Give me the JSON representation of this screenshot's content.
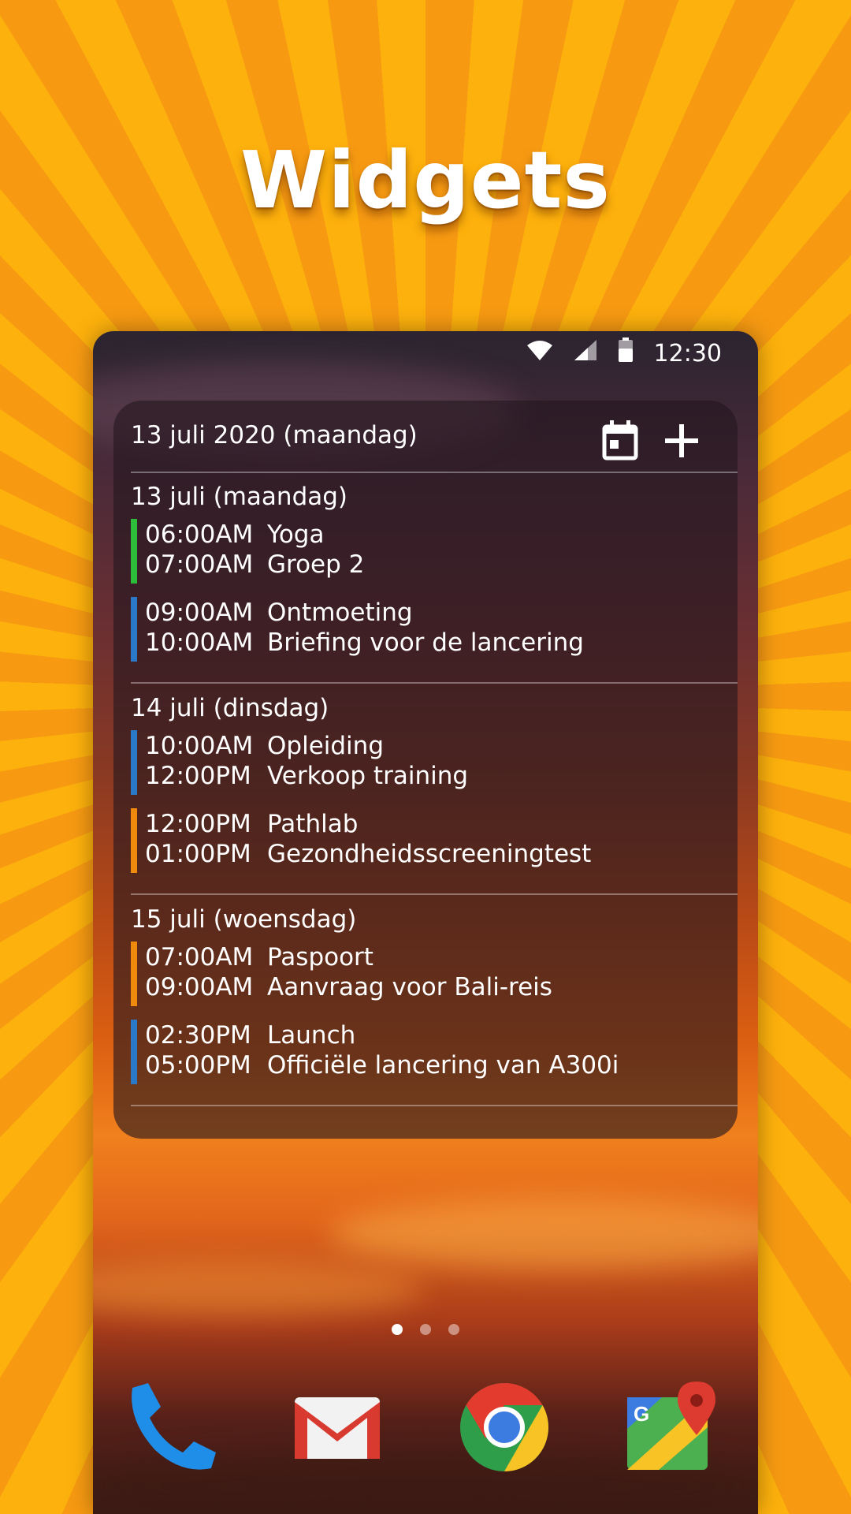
{
  "headline": "Widgets",
  "status_bar": {
    "time": "12:30",
    "icons": [
      "wifi-icon",
      "signal-icon",
      "battery-icon"
    ]
  },
  "widget": {
    "title": "13 juli 2020 (maandag)",
    "buttons": {
      "calendar_icon": "calendar-icon",
      "add_icon": "plus-icon"
    },
    "days": [
      {
        "label": "13 juli (maandag)",
        "events": [
          {
            "start": "06:00AM",
            "title": "Yoga",
            "end": "07:00AM",
            "detail": "Groep 2",
            "color": "#2dbd3a"
          },
          {
            "start": "09:00AM",
            "title": "Ontmoeting",
            "end": "10:00AM",
            "detail": "Briefing voor de lancering",
            "color": "#2a78c8"
          }
        ]
      },
      {
        "label": "14 juli (dinsdag)",
        "events": [
          {
            "start": "10:00AM",
            "title": "Opleiding",
            "end": "12:00PM",
            "detail": "Verkoop training",
            "color": "#2a78c8"
          },
          {
            "start": "12:00PM",
            "title": "Pathlab",
            "end": "01:00PM",
            "detail": "Gezondheidsscreeningtest",
            "color": "#f08a0c"
          }
        ]
      },
      {
        "label": "15 juli (woensdag)",
        "events": [
          {
            "start": "07:00AM",
            "title": "Paspoort",
            "end": "09:00AM",
            "detail": "Aanvraag voor Bali-reis",
            "color": "#f08a0c"
          },
          {
            "start": "02:30PM",
            "title": "Launch",
            "end": "05:00PM",
            "detail": "Officiële lancering van A300i",
            "color": "#2a78c8"
          }
        ]
      }
    ]
  },
  "page_indicator": {
    "count": 3,
    "active": 0
  },
  "dock": [
    "phone-app-icon",
    "gmail-app-icon",
    "chrome-app-icon",
    "maps-app-icon"
  ]
}
